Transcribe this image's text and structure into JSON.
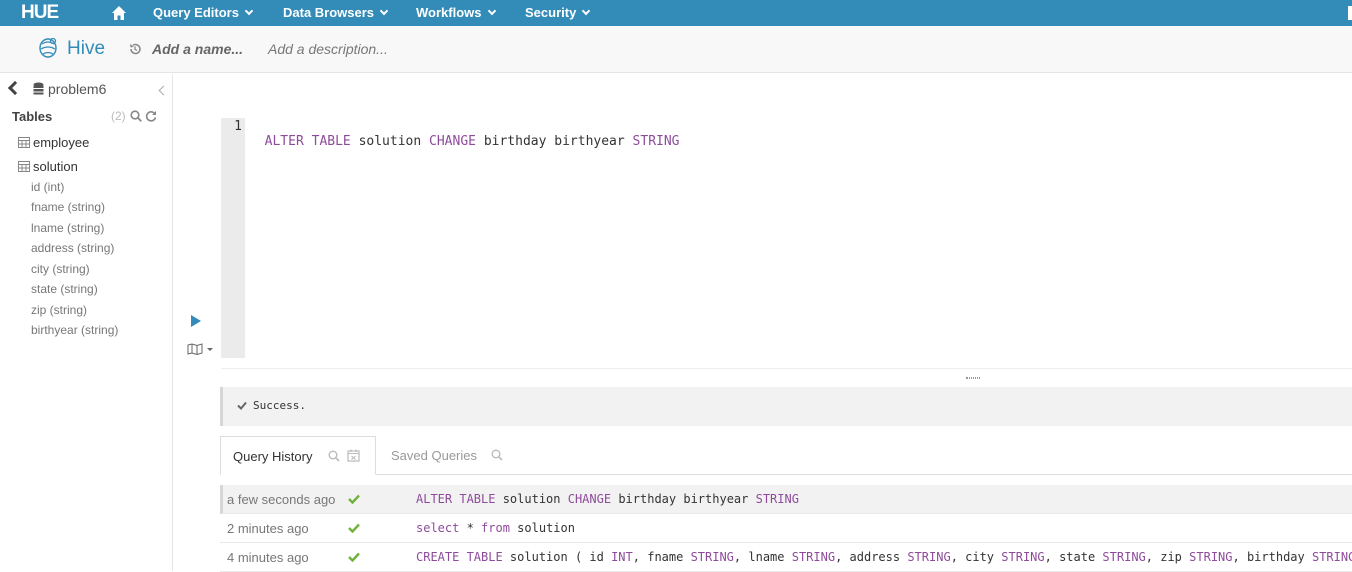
{
  "nav": {
    "logo": "HUE",
    "items": [
      {
        "label": "Query Editors"
      },
      {
        "label": "Data Browsers"
      },
      {
        "label": "Workflows"
      },
      {
        "label": "Security"
      }
    ]
  },
  "editor_header": {
    "app_title": "Hive",
    "name_placeholder": "Add a name...",
    "description_placeholder": "Add a description..."
  },
  "sidebar": {
    "database": "problem6",
    "tables_label": "Tables",
    "tables_count": "(2)",
    "tables": [
      {
        "name": "employee"
      },
      {
        "name": "solution",
        "columns": [
          "id (int)",
          "fname (string)",
          "lname (string)",
          "address (string)",
          "city (string)",
          "state (string)",
          "zip (string)",
          "birthyear (string)"
        ]
      }
    ]
  },
  "editor": {
    "line_number": "1",
    "tokens": [
      {
        "text": "ALTER TABLE",
        "kw": true
      },
      {
        "text": " solution ",
        "kw": false
      },
      {
        "text": "CHANGE",
        "kw": true
      },
      {
        "text": " birthday birthyear ",
        "kw": false
      },
      {
        "text": "STRING",
        "kw": true
      }
    ]
  },
  "result": {
    "status": "Success."
  },
  "tabs": {
    "history_label": "Query History",
    "saved_label": "Saved Queries"
  },
  "history": [
    {
      "time": "a few seconds ago",
      "status": "success",
      "selected": true,
      "tokens": [
        {
          "text": "ALTER TABLE",
          "kw": true
        },
        {
          "text": " solution ",
          "kw": false
        },
        {
          "text": "CHANGE",
          "kw": true
        },
        {
          "text": " birthday birthyear ",
          "kw": false
        },
        {
          "text": "STRING",
          "kw": true
        }
      ]
    },
    {
      "time": "2 minutes ago",
      "status": "success",
      "selected": false,
      "tokens": [
        {
          "text": "select",
          "kw": true
        },
        {
          "text": " * ",
          "kw": false
        },
        {
          "text": "from",
          "kw": true
        },
        {
          "text": " solution",
          "kw": false
        }
      ]
    },
    {
      "time": "4 minutes ago",
      "status": "success",
      "selected": false,
      "tokens": [
        {
          "text": "CREATE TABLE",
          "kw": true
        },
        {
          "text": " solution ( id ",
          "kw": false
        },
        {
          "text": "INT",
          "kw": true
        },
        {
          "text": ", fname ",
          "kw": false
        },
        {
          "text": "STRING",
          "kw": true
        },
        {
          "text": ", lname ",
          "kw": false
        },
        {
          "text": "STRING",
          "kw": true
        },
        {
          "text": ", address ",
          "kw": false
        },
        {
          "text": "STRING",
          "kw": true
        },
        {
          "text": ", city ",
          "kw": false
        },
        {
          "text": "STRING",
          "kw": true
        },
        {
          "text": ", state ",
          "kw": false
        },
        {
          "text": "STRING",
          "kw": true
        },
        {
          "text": ", zip ",
          "kw": false
        },
        {
          "text": "STRING",
          "kw": true
        },
        {
          "text": ", birthday ",
          "kw": false
        },
        {
          "text": "STRING",
          "kw": true
        },
        {
          "text": " )",
          "kw": false
        }
      ]
    }
  ],
  "colors": {
    "brand": "#338bb8",
    "keyword": "#8e4b9b",
    "success": "#6fb23a"
  }
}
